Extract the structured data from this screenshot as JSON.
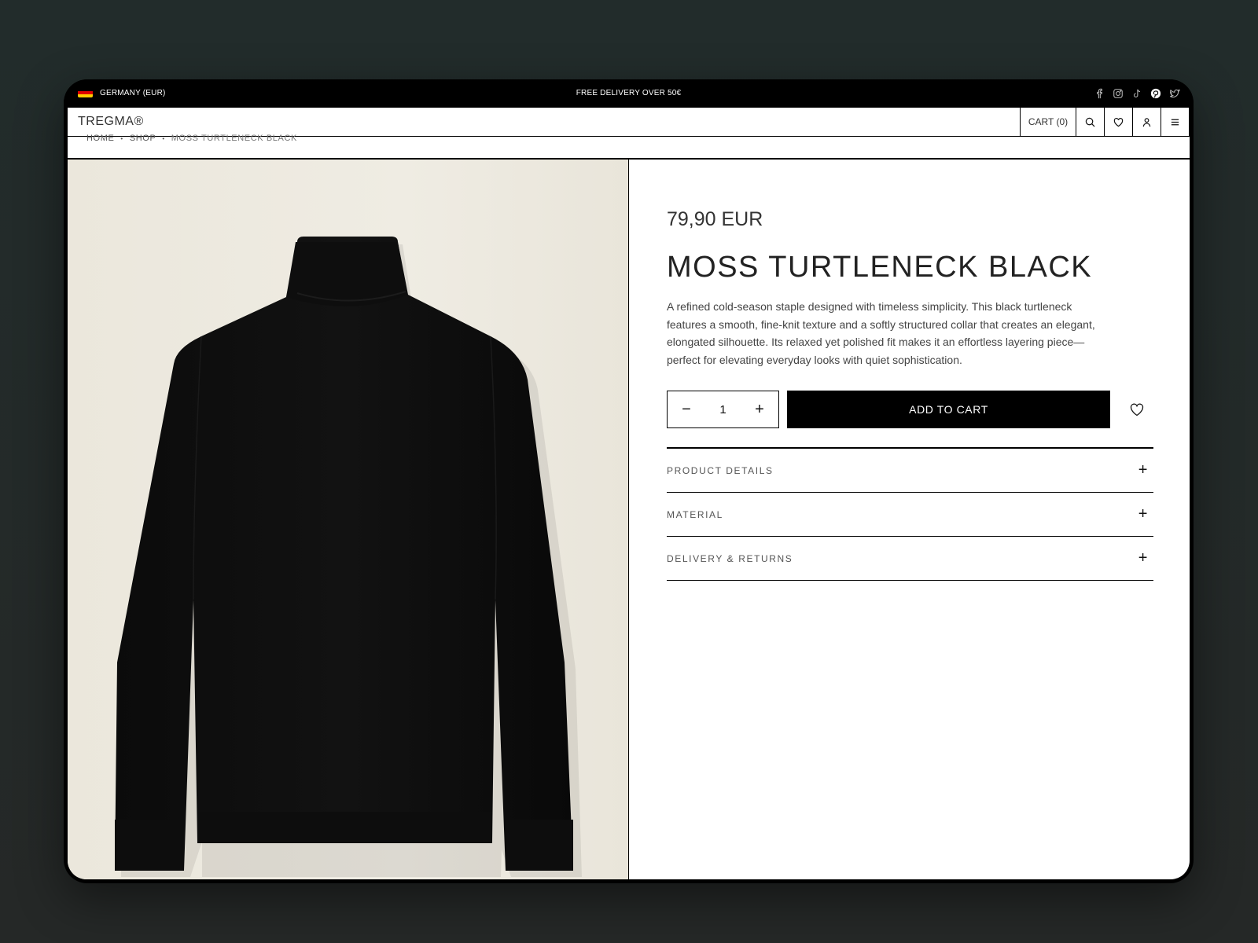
{
  "topbar": {
    "region": "GERMANY (EUR)",
    "promo": "FREE DELIVERY OVER 50€",
    "socials": [
      "facebook-icon",
      "instagram-icon",
      "tiktok-icon",
      "pinterest-icon",
      "twitter-icon"
    ]
  },
  "header": {
    "logo": "TREGMA®",
    "cart_label": "CART (0)"
  },
  "breadcrumb": [
    "HOME",
    "SHOP",
    "MOSS TURTLENECK BLACK"
  ],
  "product": {
    "price": "79,90 EUR",
    "title": "MOSS TURTLENECK BLACK",
    "description": "A refined cold-season staple designed with timeless simplicity. This black turtleneck features a smooth, fine-knit texture and a softly structured collar that creates an elegant, elongated silhouette. Its relaxed yet polished fit makes it an effortless layering piece—perfect for elevating everyday looks with quiet sophistication.",
    "quantity": "1",
    "qty_minus": "−",
    "qty_plus": "+",
    "add_to_cart": "ADD TO CART"
  },
  "accordion": [
    {
      "label": "PRODUCT DETAILS",
      "icon": "+"
    },
    {
      "label": "MATERIAL",
      "icon": "+"
    },
    {
      "label": "DELIVERY & RETURNS",
      "icon": "+"
    }
  ],
  "colors": {
    "background": "#232b2a",
    "accent": "#000000",
    "photo_background": "#ece8de"
  }
}
